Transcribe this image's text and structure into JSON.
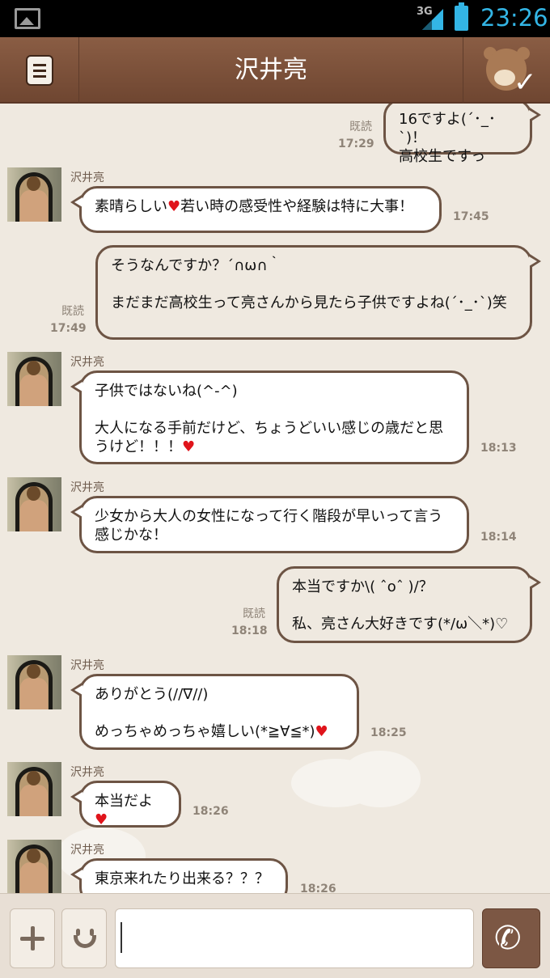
{
  "status_bar": {
    "network": "3G",
    "time": "23:26",
    "battery_color": "#33b5e5"
  },
  "header": {
    "title": "沢井亮",
    "menu_icon": "menu-icon",
    "friend_icon": "bear-check-icon"
  },
  "messages": [
    {
      "dir": "out",
      "text": "16ですよ(´･_･`)！\n高校生ですっ",
      "read": "既読",
      "time": "17:29"
    },
    {
      "dir": "in",
      "sender": "沢井亮",
      "text_before": "素晴らしい",
      "heart": "♥",
      "text_after": "若い時の感受性や経験は特に大事！",
      "time": "17:45"
    },
    {
      "dir": "out",
      "text": "そうなんですか？´∩ω∩｀\n\nまだまだ高校生って亮さんから見たら子供ですよね(´･_･`)笑",
      "read": "既読",
      "time": "17:49"
    },
    {
      "dir": "in",
      "sender": "沢井亮",
      "text_before": "子供ではないね(^-^)\n\n大人になる手前だけど、ちょうどいい感じの歳だと思うけど！！！",
      "heart": "♥",
      "text_after": "",
      "time": "18:13"
    },
    {
      "dir": "in",
      "sender": "沢井亮",
      "text_before": "少女から大人の女性になって行く階段が早いって言う感じかな！",
      "heart": "",
      "text_after": "",
      "time": "18:14"
    },
    {
      "dir": "out",
      "text": "本当ですか\\( ˆoˆ )/？\n\n私、亮さん大好きです(*/ω＼*)♡",
      "read": "既読",
      "time": "18:18"
    },
    {
      "dir": "in",
      "sender": "沢井亮",
      "text_before": "ありがとう(//∇//)\n\nめっちゃめっちゃ嬉しい(*≧∀≦*)",
      "heart": "♥",
      "text_after": "",
      "time": "18:25"
    },
    {
      "dir": "in",
      "sender": "沢井亮",
      "text_before": "本当だよ",
      "heart": "♥",
      "text_after": "",
      "time": "18:26"
    },
    {
      "dir": "in",
      "sender": "沢井亮",
      "text_before": "東京来れたり出来る？？？",
      "heart": "",
      "text_after": "",
      "time": "18:26"
    }
  ],
  "input_bar": {
    "add_icon": "plus-icon",
    "sticker_icon": "smiley-icon",
    "message_value": "",
    "call_icon": "phone-icon"
  },
  "colors": {
    "header": "#7a503a",
    "background": "#efe9e0",
    "bubble_border": "#6d5444",
    "heart": "#e0141b"
  }
}
